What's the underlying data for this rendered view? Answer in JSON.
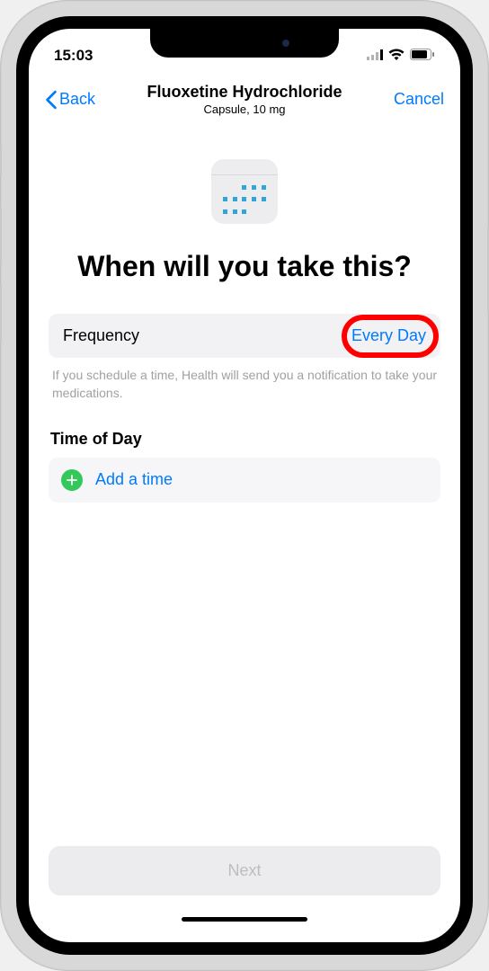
{
  "status": {
    "time": "15:03"
  },
  "nav": {
    "back": "Back",
    "title": "Fluoxetine Hydrochloride",
    "subtitle": "Capsule, 10 mg",
    "cancel": "Cancel"
  },
  "main": {
    "heading": "When will you take this?",
    "frequency_label": "Frequency",
    "frequency_value": "Every Day",
    "helper": "If you schedule a time, Health will send you a notification to take your medications.",
    "time_section": "Time of Day",
    "add_time": "Add a time",
    "next": "Next"
  }
}
